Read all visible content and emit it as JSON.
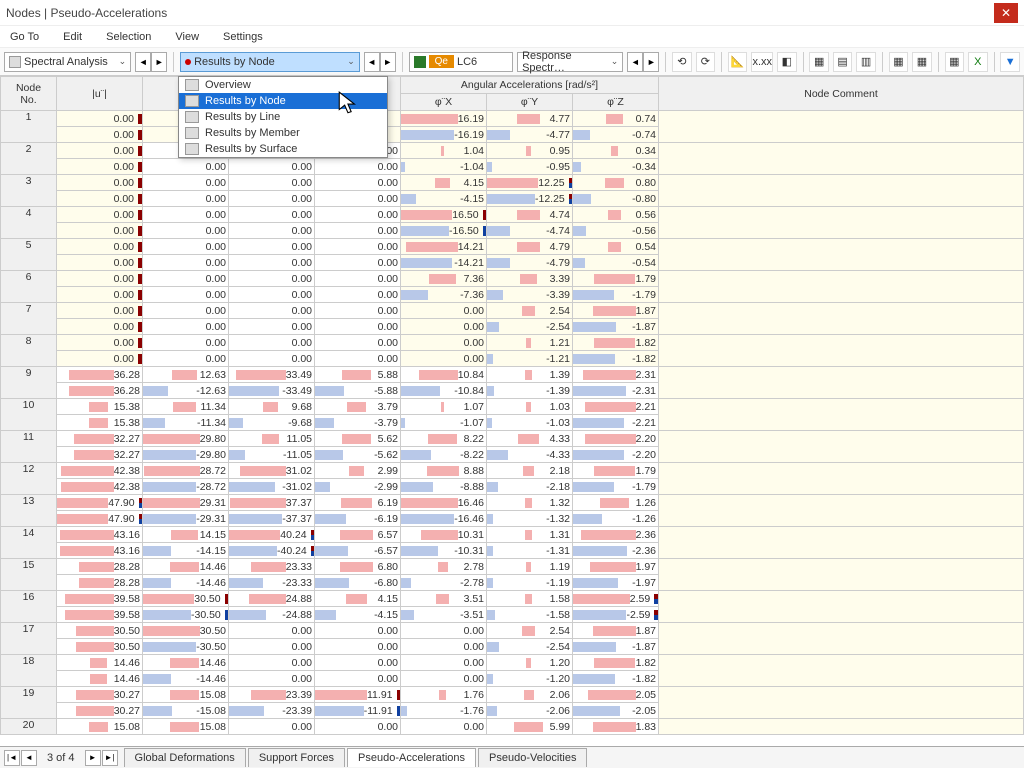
{
  "title": "Nodes | Pseudo-Accelerations",
  "menu": [
    "Go To",
    "Edit",
    "Selection",
    "View",
    "Settings"
  ],
  "toolbar": {
    "spectral": "Spectral Analysis",
    "results": "Results by Node",
    "lc_code": "LC6",
    "lc_badge": "Qe",
    "response": "Response Spectr…"
  },
  "dropdown": {
    "items": [
      "Overview",
      "Results by Node",
      "Results by Line",
      "Results by Member",
      "Results by Surface"
    ],
    "selected": 1
  },
  "headers": {
    "node": "Node\nNo.",
    "u": "|u¨|",
    "ang_group": "Angular Accelerations [rad/s²]",
    "phix": "φ¨X",
    "phiy": "φ¨Y",
    "phiz": "φ¨Z",
    "comment": "Node Comment"
  },
  "cols_hidden_count": 3,
  "rows": [
    {
      "n": 1,
      "a": [
        [
          "0.00",
          "r"
        ],
        [
          "0.00",
          "r"
        ]
      ],
      "phx": [
        "16.19",
        "-16.19"
      ],
      "phy": [
        "4.77",
        "-4.77"
      ],
      "phz": [
        "0.74",
        "-0.74"
      ]
    },
    {
      "n": 2,
      "a": [
        [
          "0.00",
          "r"
        ],
        [
          "0.00",
          "r"
        ]
      ],
      "b": [
        "0.00",
        "0.00"
      ],
      "c": [
        "0.00",
        "0.00"
      ],
      "d": [
        "0.00",
        "0.00"
      ],
      "phx": [
        "1.04",
        "-1.04"
      ],
      "phy": [
        "0.95",
        "-0.95"
      ],
      "phz": [
        "0.34",
        "-0.34"
      ]
    },
    {
      "n": 3,
      "a": [
        [
          "0.00",
          "r"
        ],
        [
          "0.00",
          "r"
        ]
      ],
      "b": [
        "0.00",
        "0.00"
      ],
      "c": [
        "0.00",
        "0.00"
      ],
      "d": [
        "0.00",
        "0.00"
      ],
      "phx": [
        "4.15",
        "-4.15"
      ],
      "phy": [
        "12.25",
        "-12.25"
      ],
      "phym": [
        "rb",
        "rb"
      ],
      "phz": [
        "0.80",
        "-0.80"
      ]
    },
    {
      "n": 4,
      "a": [
        [
          "0.00",
          "r"
        ],
        [
          "0.00",
          "r"
        ]
      ],
      "b": [
        "0.00",
        "0.00"
      ],
      "c": [
        "0.00",
        "0.00"
      ],
      "d": [
        "0.00",
        "0.00"
      ],
      "phx": [
        "16.50",
        "-16.50"
      ],
      "phxm": [
        "r",
        "b"
      ],
      "phy": [
        "4.74",
        "-4.74"
      ],
      "phz": [
        "0.56",
        "-0.56"
      ]
    },
    {
      "n": 5,
      "a": [
        [
          "0.00",
          "r"
        ],
        [
          "0.00",
          "r"
        ]
      ],
      "b": [
        "0.00",
        "0.00"
      ],
      "c": [
        "0.00",
        "0.00"
      ],
      "d": [
        "0.00",
        "0.00"
      ],
      "phx": [
        "14.21",
        "-14.21"
      ],
      "phy": [
        "4.79",
        "-4.79"
      ],
      "phz": [
        "0.54",
        "-0.54"
      ]
    },
    {
      "n": 6,
      "a": [
        [
          "0.00",
          "r"
        ],
        [
          "0.00",
          "r"
        ]
      ],
      "b": [
        "0.00",
        "0.00"
      ],
      "c": [
        "0.00",
        "0.00"
      ],
      "d": [
        "0.00",
        "0.00"
      ],
      "phx": [
        "7.36",
        "-7.36"
      ],
      "phy": [
        "3.39",
        "-3.39"
      ],
      "phz": [
        "1.79",
        "-1.79"
      ]
    },
    {
      "n": 7,
      "a": [
        [
          "0.00",
          "r"
        ],
        [
          "0.00",
          "r"
        ]
      ],
      "b": [
        "0.00",
        "0.00"
      ],
      "c": [
        "0.00",
        "0.00"
      ],
      "d": [
        "0.00",
        "0.00"
      ],
      "phx": [
        "0.00",
        "0.00"
      ],
      "phy": [
        "2.54",
        "-2.54"
      ],
      "phz": [
        "1.87",
        "-1.87"
      ]
    },
    {
      "n": 8,
      "a": [
        [
          "0.00",
          "r"
        ],
        [
          "0.00",
          "r"
        ]
      ],
      "b": [
        "0.00",
        "0.00"
      ],
      "c": [
        "0.00",
        "0.00"
      ],
      "d": [
        "0.00",
        "0.00"
      ],
      "phx": [
        "0.00",
        "0.00"
      ],
      "phy": [
        "1.21",
        "-1.21"
      ],
      "phz": [
        "1.82",
        "-1.82"
      ]
    },
    {
      "n": 9,
      "a": [
        [
          "36.28",
          ""
        ],
        [
          "36.28",
          ""
        ]
      ],
      "b": [
        "12.63",
        "-12.63"
      ],
      "c": [
        "33.49",
        "-33.49"
      ],
      "d": [
        "5.88",
        "-5.88"
      ],
      "phx": [
        "10.84",
        "-10.84"
      ],
      "phy": [
        "1.39",
        "-1.39"
      ],
      "phz": [
        "2.31",
        "-2.31"
      ]
    },
    {
      "n": 10,
      "a": [
        [
          "15.38",
          ""
        ],
        [
          "15.38",
          ""
        ]
      ],
      "b": [
        "11.34",
        "-11.34"
      ],
      "c": [
        "9.68",
        "-9.68"
      ],
      "d": [
        "3.79",
        "-3.79"
      ],
      "phx": [
        "1.07",
        "-1.07"
      ],
      "phy": [
        "1.03",
        "-1.03"
      ],
      "phz": [
        "2.21",
        "-2.21"
      ]
    },
    {
      "n": 11,
      "a": [
        [
          "32.27",
          ""
        ],
        [
          "32.27",
          ""
        ]
      ],
      "b": [
        "29.80",
        "-29.80"
      ],
      "c": [
        "11.05",
        "-11.05"
      ],
      "d": [
        "5.62",
        "-5.62"
      ],
      "phx": [
        "8.22",
        "-8.22"
      ],
      "phy": [
        "4.33",
        "-4.33"
      ],
      "phz": [
        "2.20",
        "-2.20"
      ]
    },
    {
      "n": 12,
      "a": [
        [
          "42.38",
          ""
        ],
        [
          "42.38",
          ""
        ]
      ],
      "b": [
        "28.72",
        "-28.72"
      ],
      "c": [
        "31.02",
        "-31.02"
      ],
      "d": [
        "2.99",
        "-2.99"
      ],
      "phx": [
        "8.88",
        "-8.88"
      ],
      "phy": [
        "2.18",
        "-2.18"
      ],
      "phz": [
        "1.79",
        "-1.79"
      ]
    },
    {
      "n": 13,
      "a": [
        [
          "47.90",
          "rb"
        ],
        [
          "47.90",
          "rb"
        ]
      ],
      "b": [
        "29.31",
        "-29.31"
      ],
      "c": [
        "37.37",
        "-37.37"
      ],
      "d": [
        "6.19",
        "-6.19"
      ],
      "phx": [
        "16.46",
        "-16.46"
      ],
      "phy": [
        "1.32",
        "-1.32"
      ],
      "phz": [
        "1.26",
        "-1.26"
      ]
    },
    {
      "n": 14,
      "a": [
        [
          "43.16",
          ""
        ],
        [
          "43.16",
          ""
        ]
      ],
      "b": [
        "14.15",
        "-14.15"
      ],
      "c": [
        "40.24",
        "-40.24"
      ],
      "cm": [
        "rb",
        "rb"
      ],
      "d": [
        "6.57",
        "-6.57"
      ],
      "phx": [
        "10.31",
        "-10.31"
      ],
      "phy": [
        "1.31",
        "-1.31"
      ],
      "phz": [
        "2.36",
        "-2.36"
      ]
    },
    {
      "n": 15,
      "a": [
        [
          "28.28",
          ""
        ],
        [
          "28.28",
          ""
        ]
      ],
      "b": [
        "14.46",
        "-14.46"
      ],
      "c": [
        "23.33",
        "-23.33"
      ],
      "d": [
        "6.80",
        "-6.80"
      ],
      "phx": [
        "2.78",
        "-2.78"
      ],
      "phy": [
        "1.19",
        "-1.19"
      ],
      "phz": [
        "1.97",
        "-1.97"
      ]
    },
    {
      "n": 16,
      "a": [
        [
          "39.58",
          ""
        ],
        [
          "39.58",
          ""
        ]
      ],
      "b": [
        "30.50",
        "-30.50"
      ],
      "bm": [
        "r",
        "b"
      ],
      "c": [
        "24.88",
        "-24.88"
      ],
      "d": [
        "4.15",
        "-4.15"
      ],
      "phx": [
        "3.51",
        "-3.51"
      ],
      "phy": [
        "1.58",
        "-1.58"
      ],
      "phz": [
        "2.59",
        "-2.59"
      ],
      "phzm": [
        "rb",
        "rb"
      ]
    },
    {
      "n": 17,
      "a": [
        [
          "30.50",
          ""
        ],
        [
          "30.50",
          ""
        ]
      ],
      "b": [
        "30.50",
        "-30.50"
      ],
      "c": [
        "0.00",
        "0.00"
      ],
      "d": [
        "0.00",
        "0.00"
      ],
      "phx": [
        "0.00",
        "0.00"
      ],
      "phy": [
        "2.54",
        "-2.54"
      ],
      "phz": [
        "1.87",
        "-1.87"
      ]
    },
    {
      "n": 18,
      "a": [
        [
          "14.46",
          ""
        ],
        [
          "14.46",
          ""
        ]
      ],
      "b": [
        "14.46",
        "-14.46"
      ],
      "c": [
        "0.00",
        "0.00"
      ],
      "d": [
        "0.00",
        "0.00"
      ],
      "phx": [
        "0.00",
        "0.00"
      ],
      "phy": [
        "1.20",
        "-1.20"
      ],
      "phz": [
        "1.82",
        "-1.82"
      ]
    },
    {
      "n": 19,
      "a": [
        [
          "30.27",
          ""
        ],
        [
          "30.27",
          ""
        ]
      ],
      "b": [
        "15.08",
        "-15.08"
      ],
      "c": [
        "23.39",
        "-23.39"
      ],
      "d": [
        "11.91",
        "-11.91"
      ],
      "dm": [
        "r",
        "b"
      ],
      "phx": [
        "1.76",
        "-1.76"
      ],
      "phy": [
        "2.06",
        "-2.06"
      ],
      "phz": [
        "2.05",
        "-2.05"
      ]
    },
    {
      "n": 20,
      "a": [
        [
          "15.08",
          ""
        ]
      ],
      "b": [
        "15.08"
      ],
      "c": [
        "0.00"
      ],
      "d": [
        "0.00"
      ],
      "phx": [
        "0.00"
      ],
      "phy": [
        "5.99"
      ],
      "phz": [
        "1.83"
      ]
    }
  ],
  "maxes": {
    "a": 47.9,
    "b": 30.5,
    "c": 40.24,
    "d": 11.91,
    "phx": 16.5,
    "phy": 12.25,
    "phz": 2.59
  },
  "footer": {
    "page": "3 of 4",
    "tabs": [
      "Global Deformations",
      "Support Forces",
      "Pseudo-Accelerations",
      "Pseudo-Velocities"
    ],
    "active": 2
  }
}
